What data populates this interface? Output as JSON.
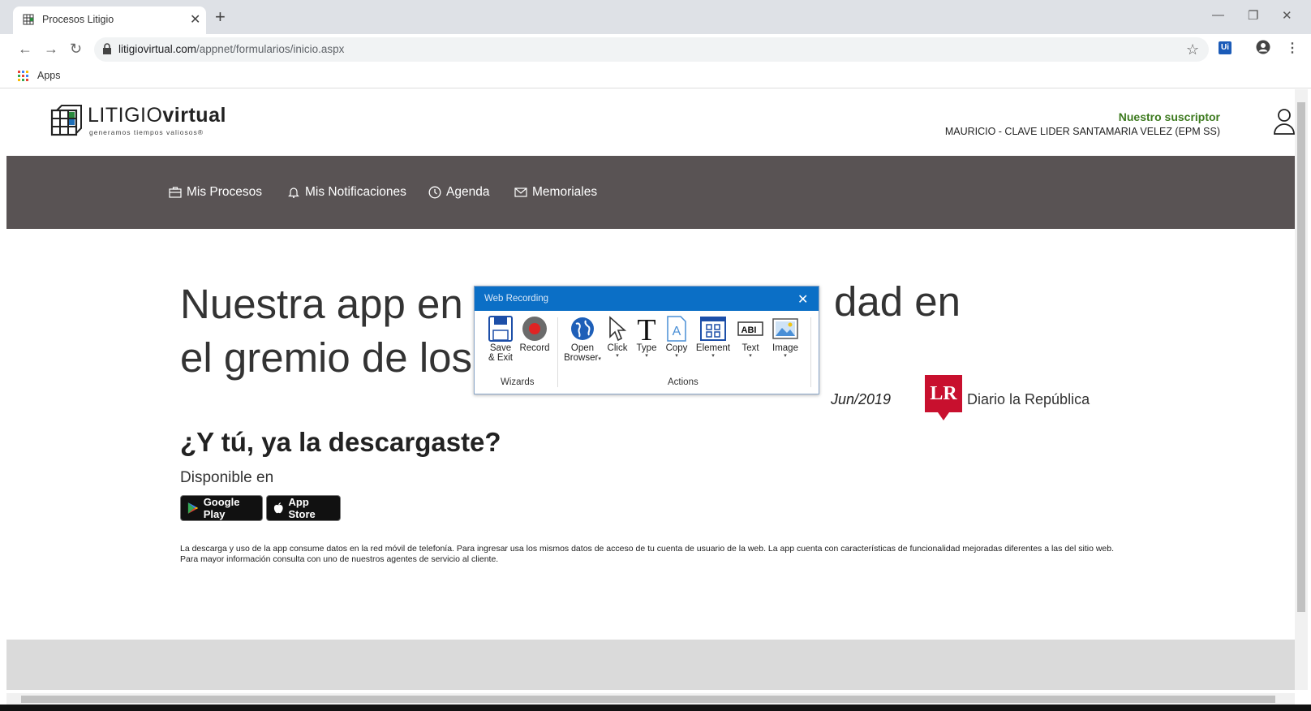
{
  "browser": {
    "tab_title": "Procesos Litigio",
    "url_host": "litigiovirtual.com",
    "url_path": "/appnet/formularios/inicio.aspx",
    "bookmark_apps": "Apps",
    "extension_label": "Ui"
  },
  "site": {
    "logo_light": "LITIGIO",
    "logo_bold": "virtual",
    "logo_tagline": "generamos tiempos valiosos®",
    "subscriber_label": "Nuestro suscriptor",
    "subscriber_name": "MAURICIO - CLAVE LIDER SANTAMARIA VELEZ (EPM SS)",
    "nav": [
      {
        "label": "Mis Procesos",
        "icon": "briefcase-icon"
      },
      {
        "label": "Mis Notificaciones",
        "icon": "bell-icon"
      },
      {
        "label": "Agenda",
        "icon": "clock-icon"
      },
      {
        "label": "Memoriales",
        "icon": "envelope-icon"
      }
    ],
    "headline_line1": "Nuestra app en",
    "headline_line2": "el gremio de los",
    "headline_tail": "dad en",
    "news_date": "Jun/2019",
    "news_logo": "LR",
    "news_source": "Diario la República",
    "subheadline": "¿Y tú, ya la descargaste?",
    "available": "Disponible en",
    "google_play": "Google Play",
    "app_store": "App Store",
    "disclaimer": "La descarga y uso de la app consume datos en la red móvil de telefonía. Para ingresar usa los mismos datos de acceso de tu cuenta de usuario de la web. La app cuenta con características de funcionalidad mejoradas diferentes a las del sitio web. Para mayor información consulta con uno de nuestros agentes de servicio al cliente."
  },
  "web_recording": {
    "title": "Web Recording",
    "buttons": {
      "save_exit_1": "Save",
      "save_exit_2": "& Exit",
      "record": "Record",
      "open_browser_1": "Open",
      "open_browser_2": "Browser",
      "click": "Click",
      "type": "Type",
      "copy": "Copy",
      "element": "Element",
      "text": "Text",
      "image": "Image"
    },
    "groups": {
      "wizards": "Wizards",
      "actions": "Actions"
    }
  }
}
